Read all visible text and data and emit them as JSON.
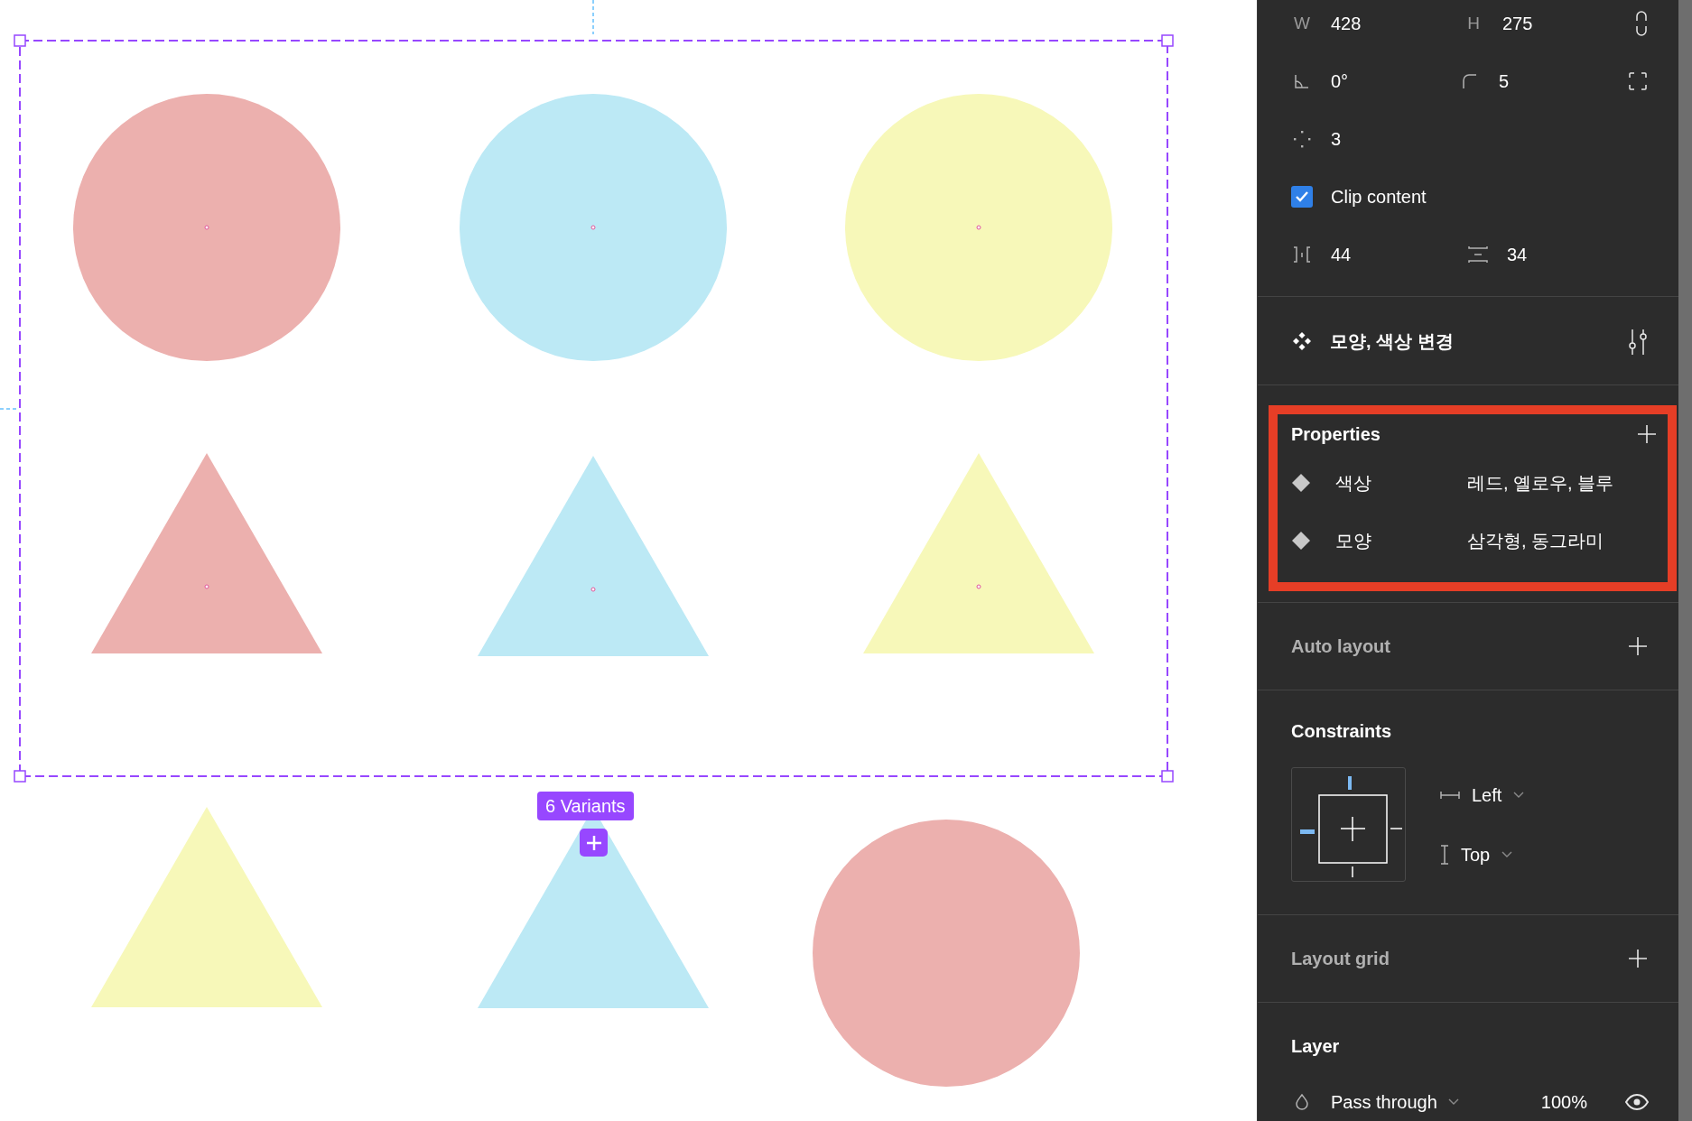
{
  "canvas": {
    "variant_badge": "6 Variants",
    "shapes": [
      {
        "kind": "circle",
        "color": "#ecb0ae"
      },
      {
        "kind": "circle",
        "color": "#bce9f5"
      },
      {
        "kind": "circle",
        "color": "#f7f8b9"
      },
      {
        "kind": "triangle",
        "color": "#ecb0ae"
      },
      {
        "kind": "triangle",
        "color": "#bce9f5"
      },
      {
        "kind": "triangle",
        "color": "#f7f8b9"
      },
      {
        "kind": "triangle",
        "color": "#f7f8b9"
      },
      {
        "kind": "triangle",
        "color": "#bce9f5"
      },
      {
        "kind": "circle",
        "color": "#ecb0ae"
      }
    ]
  },
  "panel": {
    "width": {
      "label": "W",
      "value": "428"
    },
    "height": {
      "label": "H",
      "value": "275"
    },
    "rotation": "0°",
    "corner_radius": "5",
    "point_count": "3",
    "clip_content": {
      "label": "Clip content",
      "checked": true
    },
    "horizontal_spacing": "44",
    "vertical_spacing": "34",
    "component": {
      "name": "모양, 색상 변경"
    },
    "properties": {
      "title": "Properties",
      "highlighted": true,
      "items": [
        {
          "name": "색상",
          "values": "레드, 옐로우, 블루"
        },
        {
          "name": "모양",
          "values": "삼각형, 동그라미"
        }
      ]
    },
    "auto_layout": {
      "title": "Auto layout"
    },
    "constraints": {
      "title": "Constraints",
      "horizontal": "Left",
      "vertical": "Top"
    },
    "layout_grid": {
      "title": "Layout grid"
    },
    "layer": {
      "title": "Layer",
      "blend_mode": "Pass through",
      "opacity": "100%"
    }
  }
}
